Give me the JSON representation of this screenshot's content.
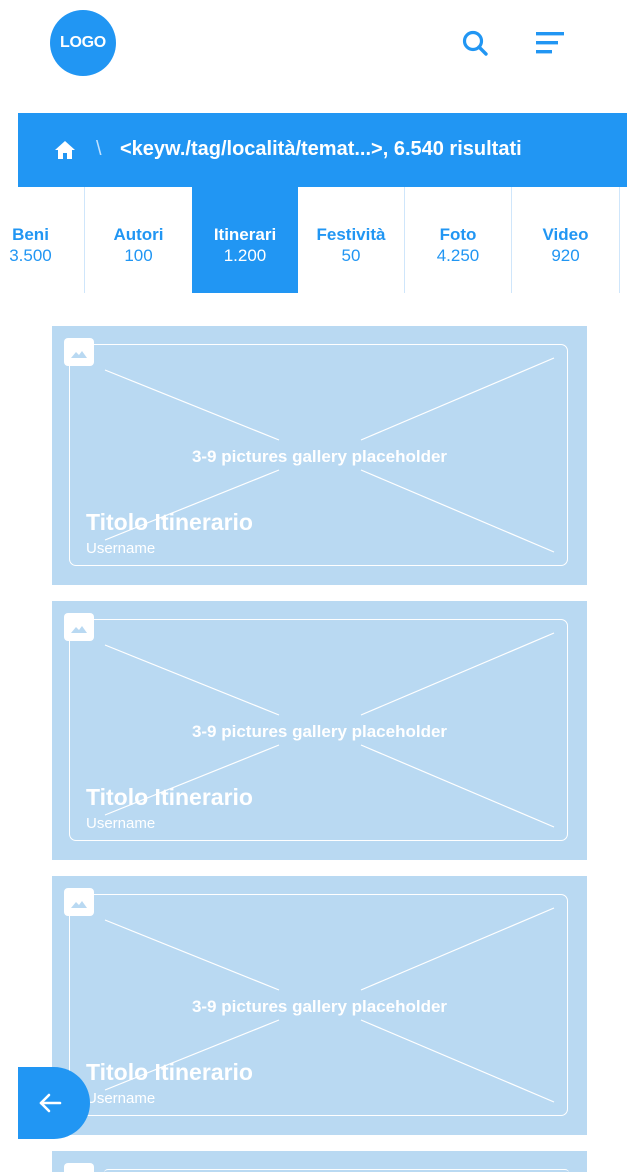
{
  "header": {
    "logo_text": "LOGO",
    "search_icon": "search-icon",
    "menu_icon": "menu-icon"
  },
  "breadcrumb": {
    "home_icon": "home-icon",
    "separator": "\\",
    "text": "<keyw./tag/località/temat...>, 6.540 risultati"
  },
  "tabs": [
    {
      "label": "Beni",
      "count": "3.500",
      "active": false
    },
    {
      "label": "Autori",
      "count": "100",
      "active": false
    },
    {
      "label": "Itinerari",
      "count": "1.200",
      "active": true
    },
    {
      "label": "Festività",
      "count": "50",
      "active": false
    },
    {
      "label": "Foto",
      "count": "4.250",
      "active": false
    },
    {
      "label": "Video",
      "count": "920",
      "active": false
    }
  ],
  "cards": [
    {
      "gallery_label": "3-9 pictures gallery placeholder",
      "title": "Titolo Itinerario",
      "user": "Username"
    },
    {
      "gallery_label": "3-9 pictures gallery placeholder",
      "title": "Titolo Itinerario",
      "user": "Username"
    },
    {
      "gallery_label": "3-9 pictures gallery placeholder",
      "title": "Titolo Itinerario",
      "user": "Username"
    }
  ],
  "colors": {
    "primary": "#2196f3",
    "card_bg": "#b9d9f2",
    "white": "#ffffff"
  },
  "fab": {
    "icon": "arrow-left-icon"
  }
}
